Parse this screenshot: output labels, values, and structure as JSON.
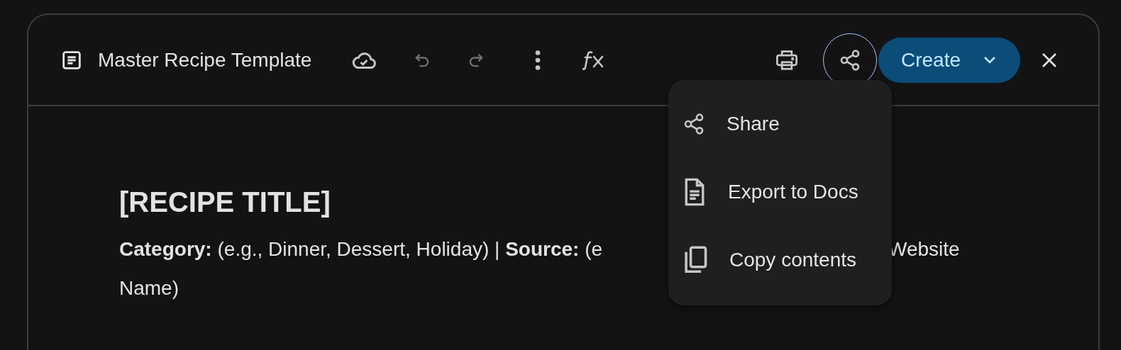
{
  "header": {
    "title": "Master Recipe Template",
    "tools": [
      {
        "kind": "cloud",
        "disabled": false
      },
      {
        "kind": "undo",
        "disabled": true
      },
      {
        "kind": "redo",
        "disabled": true
      },
      {
        "kind": "more",
        "disabled": false
      },
      {
        "kind": "fx",
        "disabled": false
      }
    ],
    "print": {
      "kind": "print"
    },
    "share": {
      "expanded": true
    },
    "create": {
      "label": "Create"
    }
  },
  "document": {
    "title": "[RECIPE TITLE]",
    "meta_line_1": "**Category:** (e.g., Dinner, Dessert, Holiday) | **Source:** (e",
    "meta_line_1_end": "Website",
    "meta_line_2": "Name)"
  },
  "share_menu": {
    "items": [
      {
        "kind": "share",
        "label": "Share"
      },
      {
        "kind": "doc",
        "label": "Export to Docs"
      },
      {
        "kind": "copy",
        "label": "Copy contents"
      }
    ]
  }
}
